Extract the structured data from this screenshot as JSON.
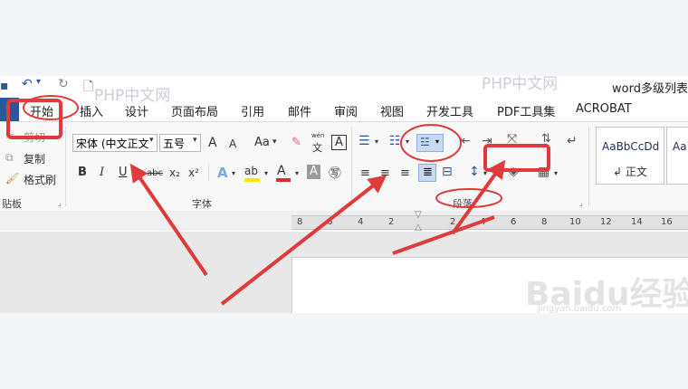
{
  "document_title": "word多级列表",
  "tabs": [
    "开始",
    "插入",
    "设计",
    "页面布局",
    "引用",
    "邮件",
    "审阅",
    "视图",
    "开发工具",
    "PDF工具集",
    "ACROBAT"
  ],
  "clipboard": {
    "cut": "剪切",
    "copy": "复制",
    "format_painter": "格式刷",
    "group_label": "贴板"
  },
  "font": {
    "font_name": "宋体 (中文正文",
    "font_size": "五号",
    "bold": "B",
    "italic": "I",
    "underline": "U",
    "strikethrough": "abc",
    "subscript": "x₂",
    "superscript": "x²",
    "change_case": "Aa",
    "grow": "A",
    "shrink": "A",
    "phonetic_top": "wén",
    "phonetic_bottom": "文",
    "border_char": "A",
    "text_effects": "A",
    "highlight": "ab",
    "font_color": "A",
    "shade": "A",
    "group_label": "字体"
  },
  "paragraph": {
    "group_label": "段落"
  },
  "styles": {
    "sample": "AaBbCcDd",
    "normal": "正文",
    "next_sample": "Aa"
  },
  "ruler_numbers": [
    "8",
    "6",
    "4",
    "2",
    "2",
    "4",
    "6",
    "8",
    "10",
    "12",
    "14",
    "16"
  ],
  "watermarks": {
    "php_cn": "PHP中文网",
    "baidu": "Baidu经验",
    "baidu_sub": "jingyan.baidu.com"
  },
  "colors": {
    "accent": "#2b579a",
    "annotation": "#e03a3a",
    "highlight_yellow": "#ffe600",
    "font_red": "#d62d2d"
  }
}
